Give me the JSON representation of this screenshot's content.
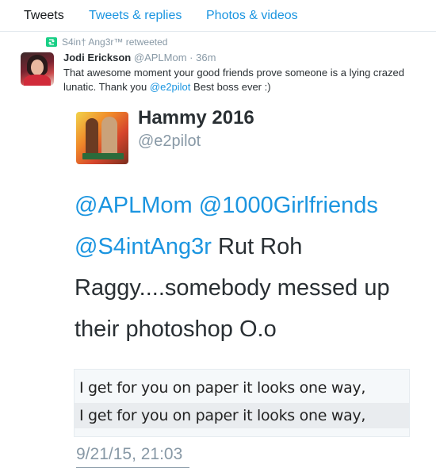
{
  "tabs": [
    {
      "label": "Tweets",
      "active": true
    },
    {
      "label": "Tweets & replies",
      "active": false
    },
    {
      "label": "Photos & videos",
      "active": false
    }
  ],
  "tweet": {
    "retweeted_by": "S4in† Ang3r™ retweeted",
    "author_name": "Jodi Erickson",
    "author_handle": "@APLMom",
    "time": "· 36m",
    "text_parts": {
      "before": "That awesome moment your good friends prove someone is a lying crazed lunatic. Thank you ",
      "mention": "@e2pilot",
      "after": " Best boss ever :)"
    }
  },
  "embedded": {
    "name": "Hammy 2016",
    "handle": "@e2pilot",
    "mentions": [
      "@APLMom",
      "@1000Girlfriends",
      "@S4intAng3r"
    ],
    "text": " Rut Roh Raggy....somebody messed up their photoshop O.o",
    "photo_lines": [
      "I get for you on paper it looks one way,",
      "I get for you  on paper it looks one way,"
    ],
    "date": "9/21/15, 21:03"
  },
  "colors": {
    "link": "#1b95e0",
    "muted": "#8899a6",
    "retweet_green": "#19cf86"
  }
}
